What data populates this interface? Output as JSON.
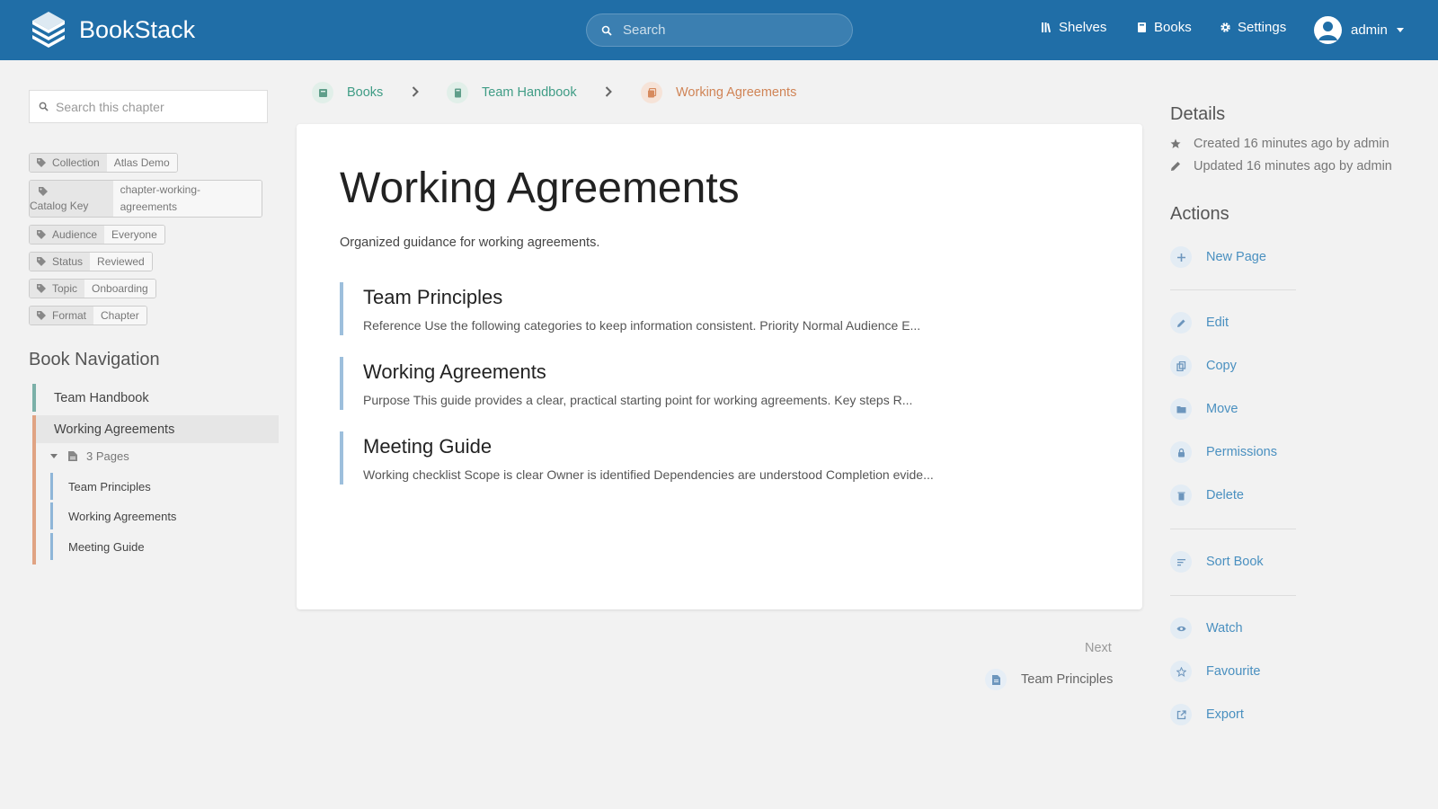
{
  "header": {
    "app_name": "BookStack",
    "search_placeholder": "Search",
    "nav": [
      {
        "label": "Shelves",
        "icon": "shelves-icon"
      },
      {
        "label": "Books",
        "icon": "books-icon"
      },
      {
        "label": "Settings",
        "icon": "gear-icon"
      }
    ],
    "user": "admin"
  },
  "sidebar": {
    "search_placeholder": "Search this chapter",
    "tags": [
      {
        "name": "Collection",
        "value": "Atlas Demo"
      },
      {
        "name": "Catalog Key",
        "value": "chapter-working-agreements"
      },
      {
        "name": "Audience",
        "value": "Everyone"
      },
      {
        "name": "Status",
        "value": "Reviewed"
      },
      {
        "name": "Topic",
        "value": "Onboarding"
      },
      {
        "name": "Format",
        "value": "Chapter"
      }
    ],
    "book_nav_title": "Book Navigation",
    "book": "Team Handbook",
    "chapter": "Working Agreements",
    "pages_toggle": "3 Pages",
    "pages": [
      "Team Principles",
      "Working Agreements",
      "Meeting Guide"
    ]
  },
  "breadcrumb": [
    "Books",
    "Team Handbook",
    "Working Agreements"
  ],
  "main": {
    "title": "Working Agreements",
    "description": "Organized guidance for working agreements.",
    "entries": [
      {
        "title": "Team Principles",
        "excerpt": "Reference Use the following categories to keep information consistent. Priority Normal Audience E..."
      },
      {
        "title": "Working Agreements",
        "excerpt": "Purpose This guide provides a clear, practical starting point for working agreements. Key steps R..."
      },
      {
        "title": "Meeting Guide",
        "excerpt": "Working checklist Scope is clear Owner is identified Dependencies are understood Completion evide..."
      }
    ],
    "next_label": "Next",
    "next_link": "Team Principles"
  },
  "details": {
    "title": "Details",
    "created": "Created 16 minutes ago by admin",
    "updated": "Updated 16 minutes ago by admin"
  },
  "actions": {
    "title": "Actions",
    "new_page": "New Page",
    "edit": "Edit",
    "copy": "Copy",
    "move": "Move",
    "permissions": "Permissions",
    "delete": "Delete",
    "sort_book": "Sort Book",
    "watch": "Watch",
    "favourite": "Favourite",
    "export": "Export"
  },
  "colors": {
    "header": "#206ea7",
    "book": "#7bb0a8",
    "chapter": "#e0a383",
    "page": "#8fb6d8",
    "link": "#4a90c0"
  }
}
